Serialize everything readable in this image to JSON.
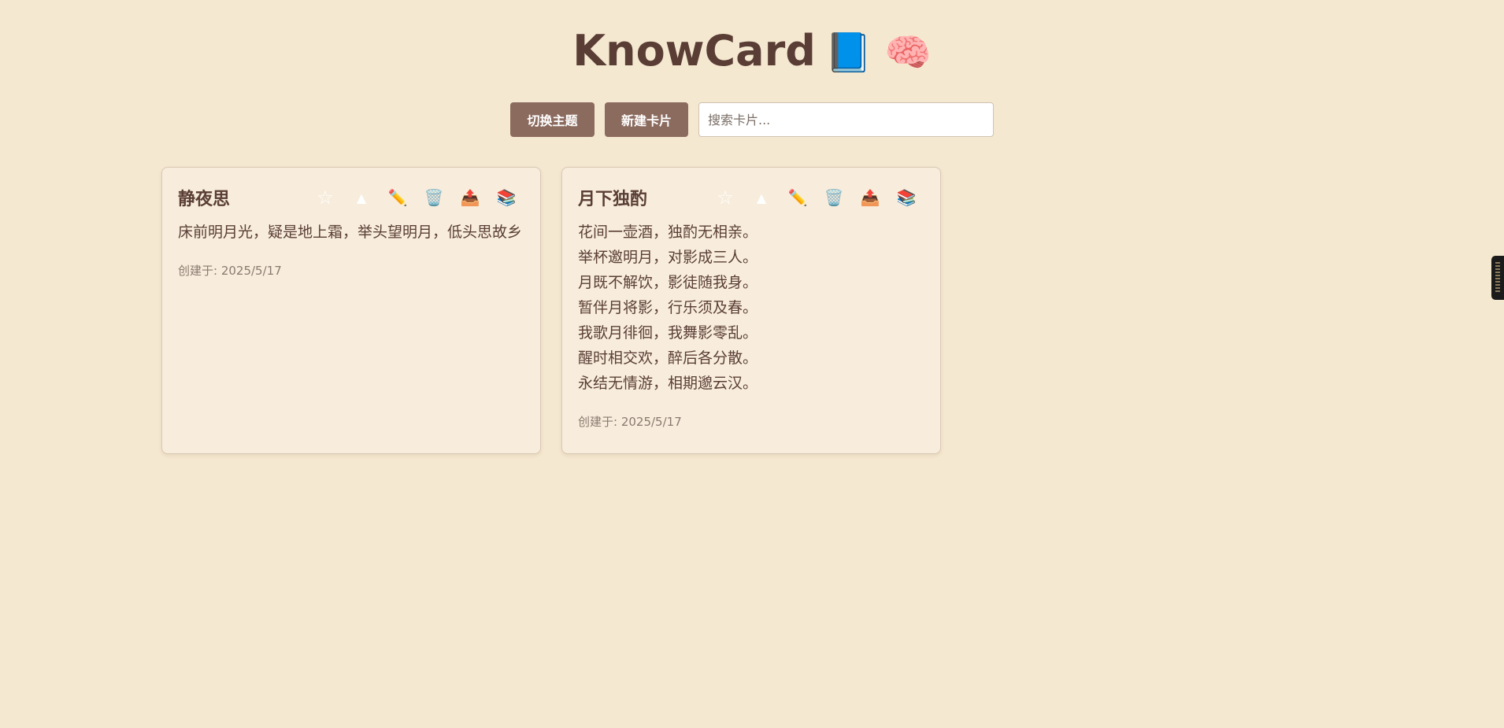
{
  "app": {
    "title": "KnowCard",
    "title_emoji": "📘 🧠"
  },
  "toolbar": {
    "theme_label": "切换主题",
    "new_label": "新建卡片",
    "search_placeholder": "搜索卡片..."
  },
  "icons": {
    "star": "☆",
    "up": "▲",
    "edit": "✏️",
    "delete": "🗑️",
    "export": "📤",
    "copy": "📚"
  },
  "cards": [
    {
      "title": "静夜思",
      "content": "床前明月光，疑是地上霜，举头望明月，低头思故乡",
      "date": "创建于: 2025/5/17"
    },
    {
      "title": "月下独酌",
      "content": "花间一壶酒，独酌无相亲。\n举杯邀明月，对影成三人。\n月既不解饮，影徒随我身。\n暂伴月将影，行乐须及春。\n我歌月徘徊，我舞影零乱。\n醒时相交欢，醉后各分散。\n永结无情游，相期邈云汉。",
      "date": "创建于: 2025/5/17"
    }
  ],
  "colors": {
    "background": "#f5e8d0",
    "button": "#8c6b5f",
    "card": "#f8eddc",
    "text": "#5a3e36"
  }
}
